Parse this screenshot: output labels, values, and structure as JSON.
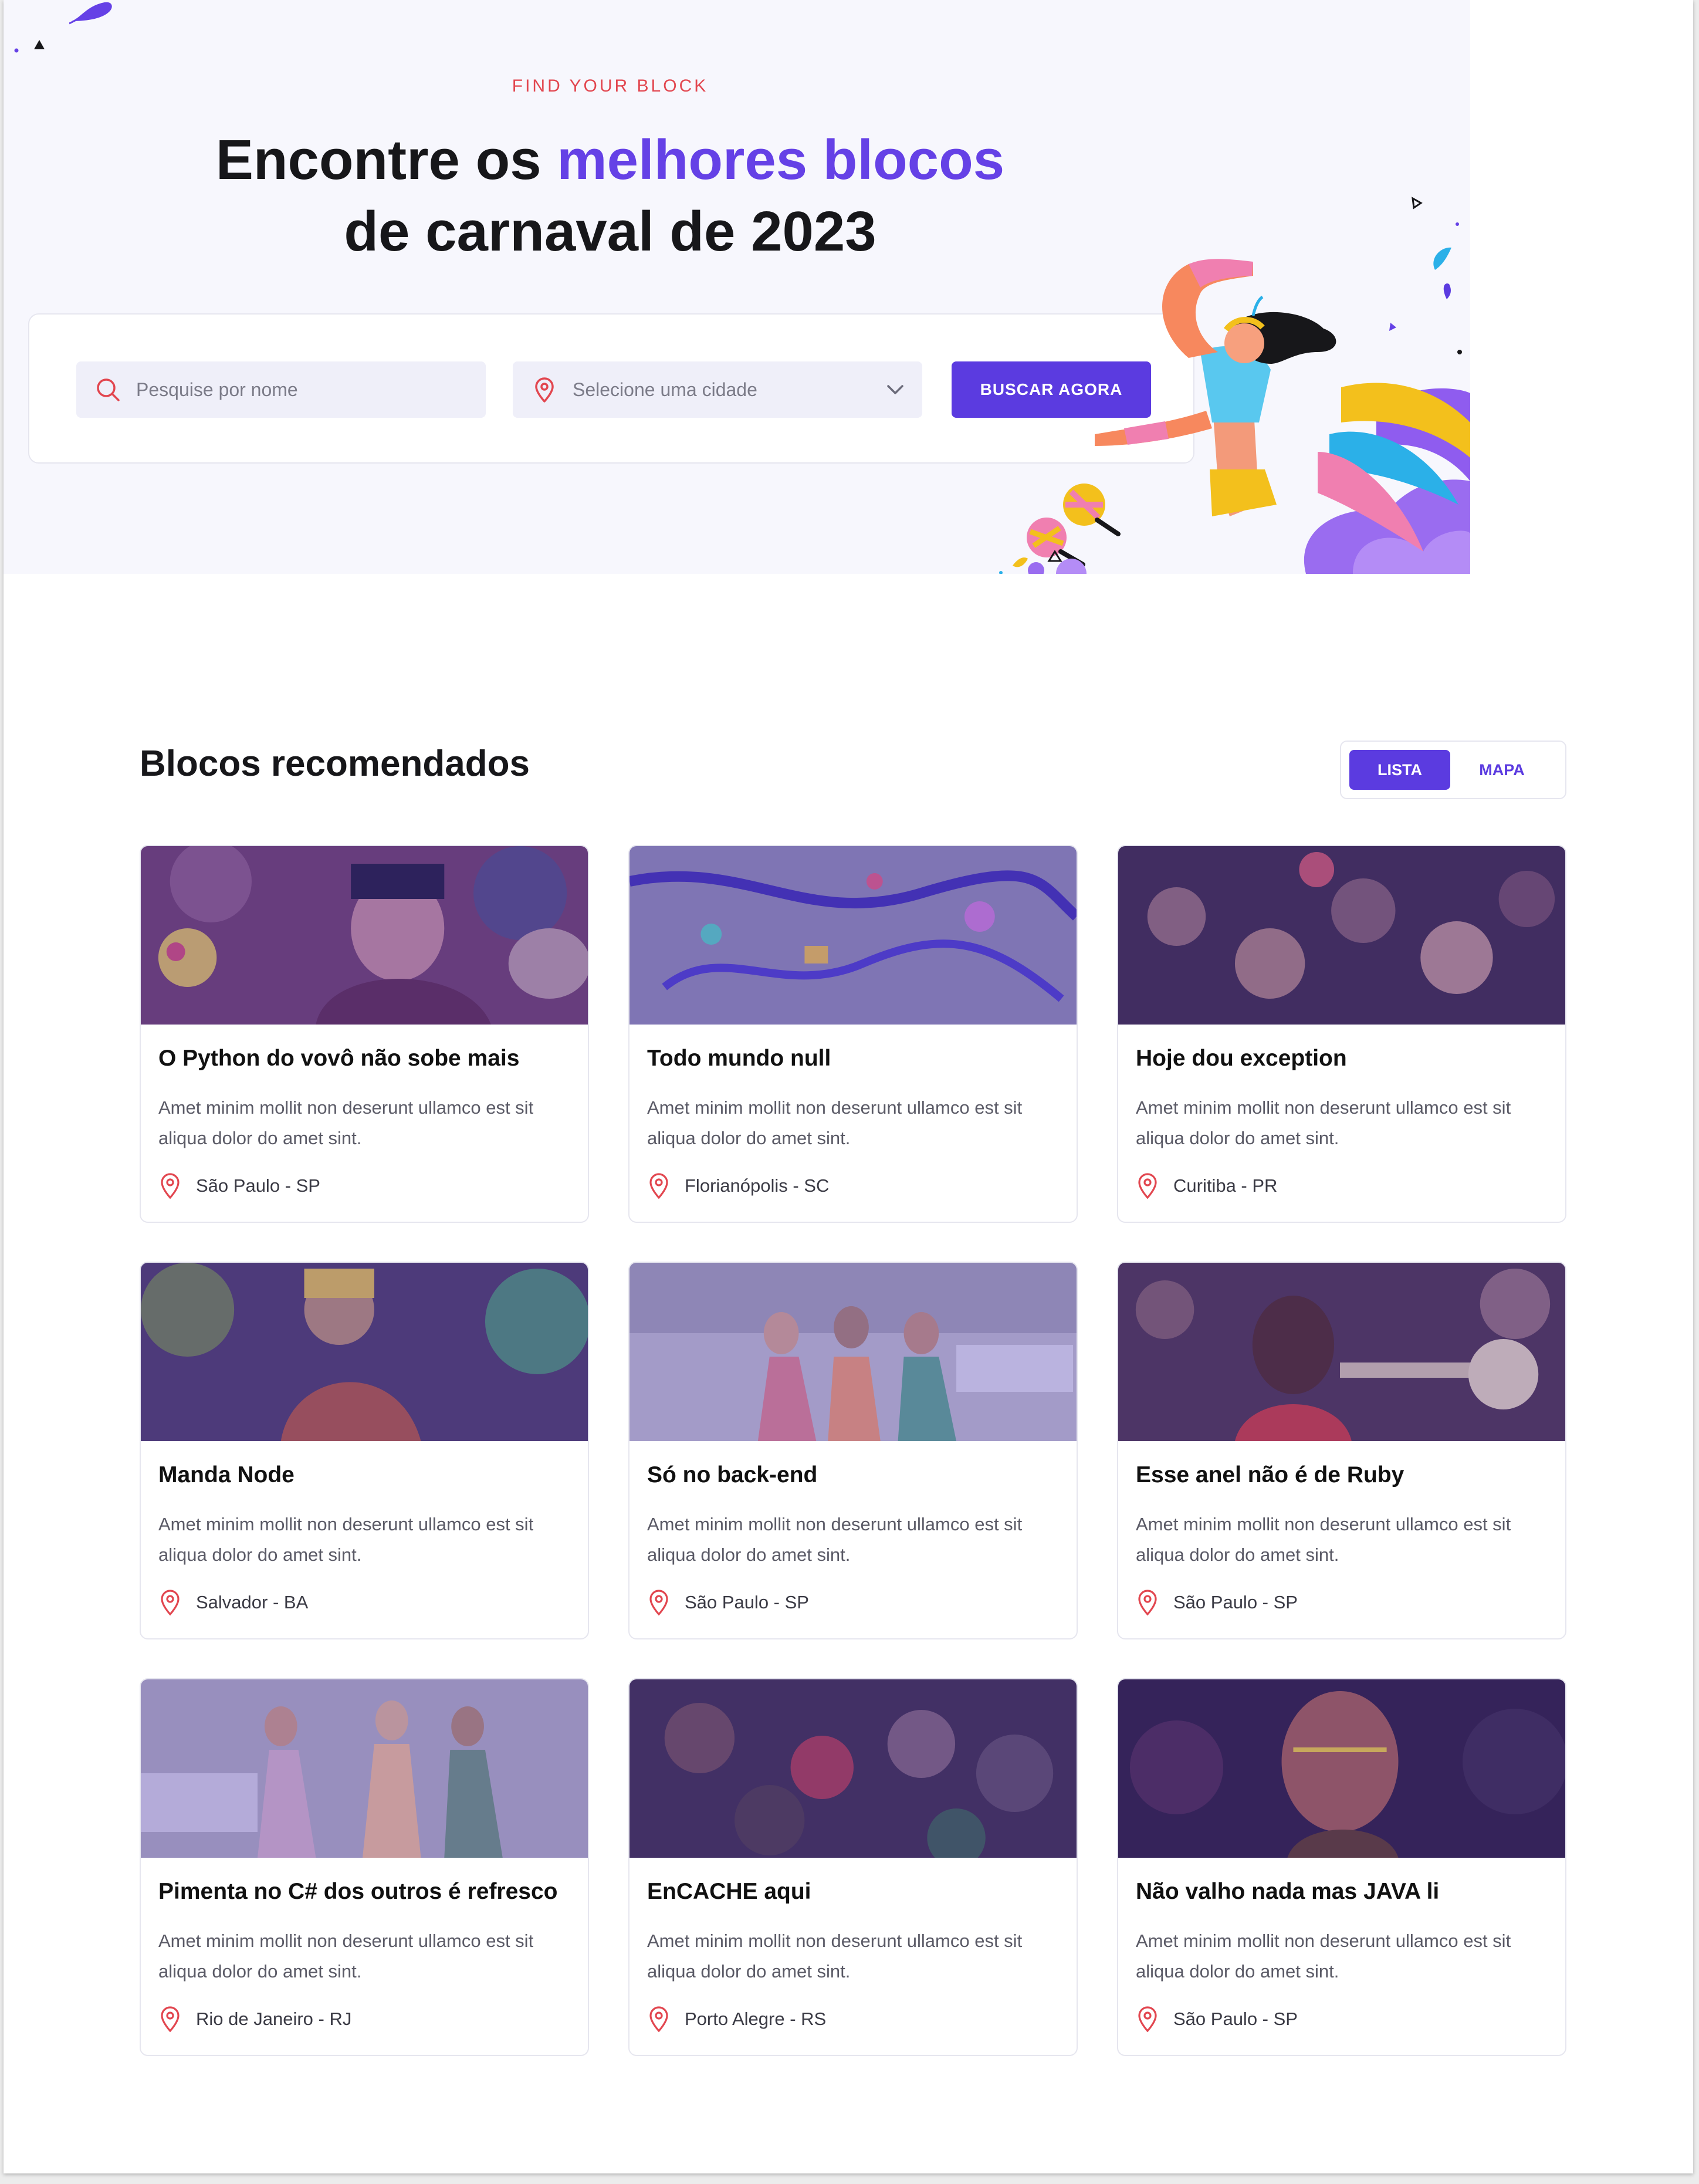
{
  "hero": {
    "eyebrow": "FIND YOUR BLOCK",
    "title_part1": "Encontre os ",
    "title_accent": "melhores blocos",
    "title_part2": "de carnaval de 2023",
    "search_placeholder": "Pesquise por nome",
    "city_placeholder": "Selecione uma cidade",
    "search_button": "BUSCAR AGORA"
  },
  "section": {
    "title": "Blocos recomendados",
    "view_list": "LISTA",
    "view_map": "MAPA",
    "active_view": "LISTA"
  },
  "cards": [
    {
      "title": "O Python do vovô não sobe mais",
      "desc": "Amet minim mollit non deserunt ullamco est sit aliqua dolor do amet sint.",
      "location": "São Paulo - SP"
    },
    {
      "title": "Todo mundo null",
      "desc": "Amet minim mollit non deserunt ullamco est sit aliqua dolor do amet sint.",
      "location": "Florianópolis - SC"
    },
    {
      "title": "Hoje dou exception",
      "desc": "Amet minim mollit non deserunt ullamco est sit aliqua dolor do amet sint.",
      "location": "Curitiba - PR"
    },
    {
      "title": "Manda Node",
      "desc": "Amet minim mollit non deserunt ullamco est sit aliqua dolor do amet sint.",
      "location": "Salvador - BA"
    },
    {
      "title": "Só no back-end",
      "desc": "Amet minim mollit non deserunt ullamco est sit aliqua dolor do amet sint.",
      "location": "São Paulo - SP"
    },
    {
      "title": "Esse anel não é de Ruby",
      "desc": "Amet minim mollit non deserunt ullamco est sit aliqua dolor do amet sint.",
      "location": "São Paulo - SP"
    },
    {
      "title": "Pimenta no C# dos outros é refresco",
      "desc": "Amet minim mollit non deserunt ullamco est sit aliqua dolor do amet sint.",
      "location": "Rio de Janeiro - RJ"
    },
    {
      "title": "EnCACHE aqui",
      "desc": "Amet minim mollit non deserunt ullamco est sit aliqua dolor do amet sint.",
      "location": "Porto Alegre - RS"
    },
    {
      "title": "Não valho nada mas JAVA li",
      "desc": "Amet minim mollit non deserunt ullamco est sit aliqua dolor do amet sint.",
      "location": "São Paulo - SP"
    }
  ],
  "colors": {
    "accent": "#5b3be0",
    "eyebrow": "#e2464f",
    "hero_bg": "#f7f7fd",
    "pin": "#e2464f"
  },
  "icons": {
    "search": "search-icon",
    "location": "map-pin-icon",
    "dropdown": "chevron-down-icon"
  }
}
